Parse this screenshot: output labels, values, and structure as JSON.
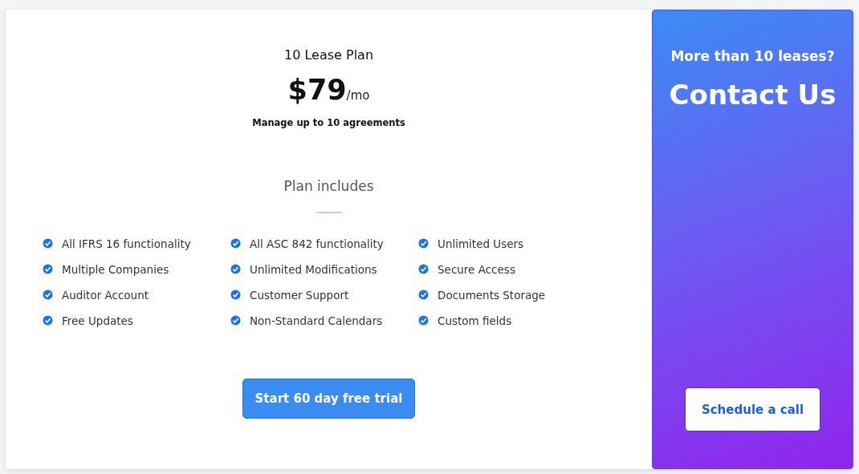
{
  "plan": {
    "title": "10 Lease Plan",
    "price": "$79",
    "period": "/mo",
    "subtitle": "Manage up to 10 agreements",
    "includes_title": "Plan includes",
    "features": [
      {
        "label": "All IFRS 16 functionality",
        "checked": true
      },
      {
        "label": "All ASC 842 functionality",
        "checked": true
      },
      {
        "label": "Unlimited Users",
        "checked": true
      },
      {
        "label": "Multiple Companies",
        "checked": true
      },
      {
        "label": "Unlimited Modifications",
        "checked": true
      },
      {
        "label": "Secure Access",
        "checked": true
      },
      {
        "label": "Auditor Account",
        "checked": true
      },
      {
        "label": "Customer Support",
        "checked": true
      },
      {
        "label": "Documents Storage",
        "checked": true
      },
      {
        "label": "Free Updates",
        "checked": true
      },
      {
        "label": "Non-Standard Calendars",
        "checked": true
      },
      {
        "label": "Custom fields",
        "checked": true
      }
    ],
    "button": "Start 60 day free trial"
  },
  "contact": {
    "question": "More than 10 leases?",
    "title": "Contact Us",
    "button": "Schedule a call"
  }
}
